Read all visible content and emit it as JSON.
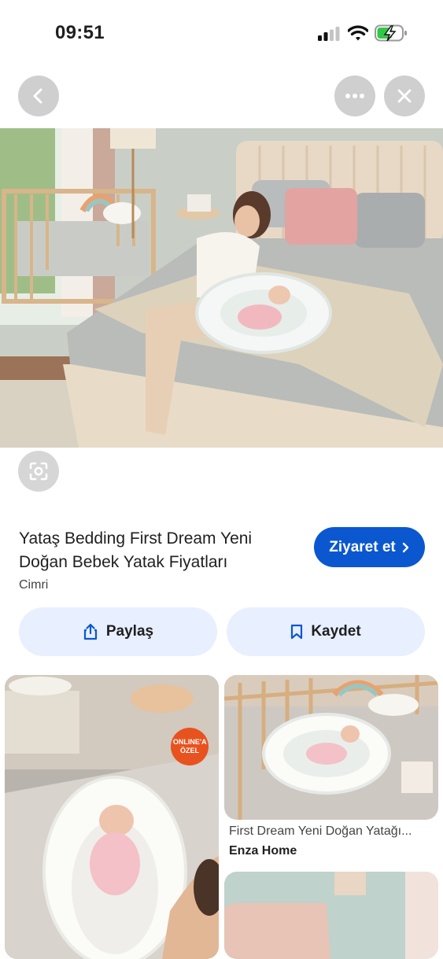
{
  "status_bar": {
    "time": "09:51"
  },
  "top_bar": {
    "back_icon": "chevron-left-icon",
    "more_icon": "more-horizontal-icon",
    "close_icon": "close-icon"
  },
  "result": {
    "title": "Yataş Bedding First Dream Yeni Doğan Bebek Yatak Fiyatları",
    "source": "Cimri",
    "visit_label": "Ziyaret et",
    "share_label": "Paylaş",
    "save_label": "Kaydet"
  },
  "related": [
    {
      "badge": "ONLINE'A ÖZEL"
    },
    {
      "caption": "First Dream Yeni Doğan Yatağı...",
      "source": "Enza Home"
    },
    {
      "caption": "",
      "source": ""
    }
  ],
  "colors": {
    "accent": "#0b57d0",
    "pill_bg": "#e8efff",
    "badge": "#e8521e"
  }
}
